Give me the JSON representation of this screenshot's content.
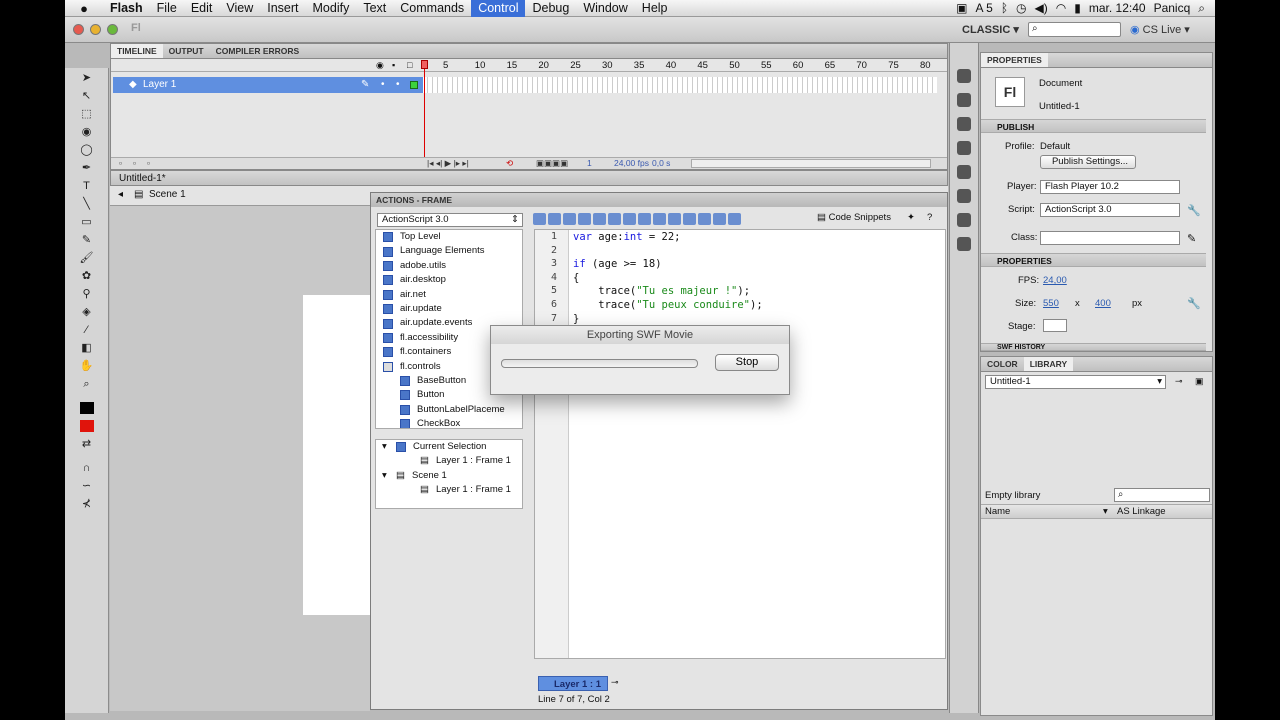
{
  "menubar": {
    "apple": "",
    "items": [
      "Flash",
      "File",
      "Edit",
      "View",
      "Insert",
      "Modify",
      "Text",
      "Commands",
      "Control",
      "Debug",
      "Window",
      "Help"
    ],
    "active": "Control",
    "status_text": "A 5",
    "time": "mar. 12:40",
    "user": "Panicq"
  },
  "toolbar": {
    "workspace": "CLASSIC ▾",
    "cs_live": "CS Live ▾"
  },
  "timeline": {
    "tabs": [
      "TIMELINE",
      "OUTPUT",
      "COMPILER ERRORS"
    ],
    "frame_numbers": [
      "5",
      "10",
      "15",
      "20",
      "25",
      "30",
      "35",
      "40",
      "45",
      "50",
      "55",
      "60",
      "65",
      "70",
      "75",
      "80"
    ],
    "layer_name": "Layer 1",
    "current_frame": "1",
    "fps": "24,00 fps",
    "elapsed": "0,0 s"
  },
  "document": {
    "tab": "Untitled-1*",
    "scene": "Scene 1"
  },
  "actions": {
    "title": "ACTIONS - FRAME",
    "language": "ActionScript 3.0",
    "tree": [
      "Top Level",
      "Language Elements",
      "adobe.utils",
      "air.desktop",
      "air.net",
      "air.update",
      "air.update.events",
      "fl.accessibility",
      "fl.containers",
      "fl.controls",
      "BaseButton",
      "Button",
      "ButtonLabelPlaceme",
      "CheckBox"
    ],
    "navigator": [
      "Current Selection",
      "Layer 1 : Frame 1",
      "Scene 1",
      "Layer 1 : Frame 1"
    ],
    "code_snippets": "Code Snippets",
    "code_lines": [
      {
        "n": "1",
        "text": "var age:int = 22;"
      },
      {
        "n": "2",
        "text": ""
      },
      {
        "n": "3",
        "text": "if (age >= 18)"
      },
      {
        "n": "4",
        "text": "{"
      },
      {
        "n": "5",
        "text": "    trace(\"Tu es majeur !\");"
      },
      {
        "n": "6",
        "text": "    trace(\"Tu peux conduire\");"
      },
      {
        "n": "7",
        "text": "}"
      }
    ],
    "layer_tab": "Layer 1 : 1",
    "status": "Line 7 of 7, Col 2"
  },
  "dialog": {
    "title": "Exporting SWF Movie",
    "stop": "Stop",
    "progress": 0
  },
  "properties": {
    "title": "PROPERTIES",
    "doc_type": "Document",
    "doc_name": "Untitled-1",
    "fl_badge": "Fl",
    "publish": "PUBLISH",
    "profile_label": "Profile:",
    "profile_value": "Default",
    "publish_settings": "Publish Settings...",
    "player_label": "Player:",
    "player_value": "Flash Player 10.2",
    "script_label": "Script:",
    "script_value": "ActionScript 3.0",
    "class_label": "Class:",
    "section_properties": "PROPERTIES",
    "fps_label": "FPS:",
    "fps_value": "24,00",
    "size_label": "Size:",
    "width": "550",
    "x": "x",
    "height": "400",
    "unit": "px",
    "stage_label": "Stage:",
    "swf_history": "SWF HISTORY"
  },
  "library": {
    "tabs": [
      "COLOR",
      "LIBRARY"
    ],
    "doc": "Untitled-1",
    "empty": "Empty library",
    "col_name": "Name",
    "col_linkage": "AS Linkage"
  }
}
